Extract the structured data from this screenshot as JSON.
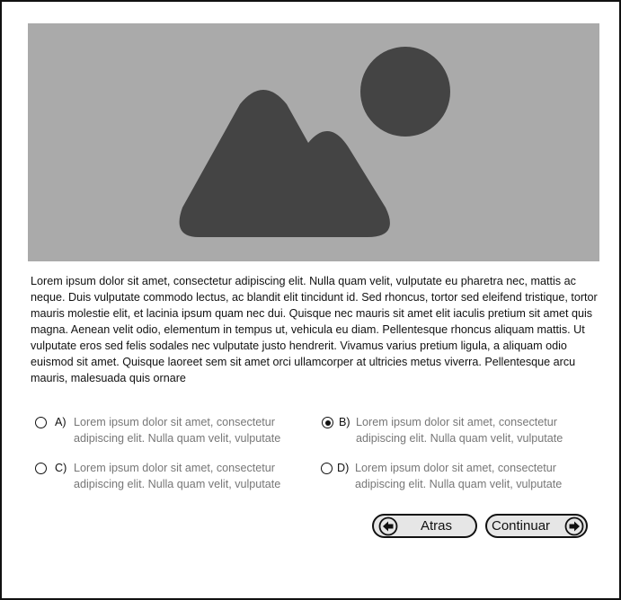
{
  "hero": {
    "image_icon": "image-placeholder-icon"
  },
  "body_text": "Lorem ipsum dolor sit amet, consectetur adipiscing elit. Nulla quam velit, vulputate eu pharetra nec, mattis ac neque. Duis vulputate commodo lectus, ac blandit elit tincidunt id. Sed rhoncus, tortor sed eleifend tristique, tortor mauris molestie elit, et lacinia ipsum quam nec dui. Quisque nec mauris sit amet elit iaculis pretium sit amet quis magna. Aenean velit odio, elementum in tempus ut, vehicula eu diam. Pellentesque rhoncus aliquam mattis. Ut vulputate eros sed felis sodales nec vulputate justo hendrerit. Vivamus varius pretium ligula, a aliquam odio euismod sit amet. Quisque laoreet sem sit amet orci ullamcorper at ultricies metus viverra. Pellentesque arcu mauris, malesuada quis ornare",
  "options": [
    {
      "letter": "A)",
      "text": "Lorem ipsum dolor sit amet, consectetur adipiscing elit. Nulla quam velit, vulputate",
      "selected": false
    },
    {
      "letter": "B)",
      "text": "Lorem ipsum dolor sit amet, consectetur adipiscing elit. Nulla quam velit, vulputate",
      "selected": true
    },
    {
      "letter": "C)",
      "text": "Lorem ipsum dolor sit amet, consectetur adipiscing elit. Nulla quam velit, vulputate",
      "selected": false
    },
    {
      "letter": "D)",
      "text": "Lorem ipsum dolor sit amet, consectetur adipiscing elit. Nulla quam velit, vulputate",
      "selected": false
    }
  ],
  "buttons": {
    "back_label": "Atras",
    "back_icon": "arrow-left-circle-icon",
    "next_label": "Continuar",
    "next_icon": "arrow-right-circle-icon"
  },
  "colors": {
    "hero_bg": "#aaaaaa",
    "hero_shape": "#444444",
    "option_text": "#777777",
    "button_bg": "#e6e6e6"
  }
}
